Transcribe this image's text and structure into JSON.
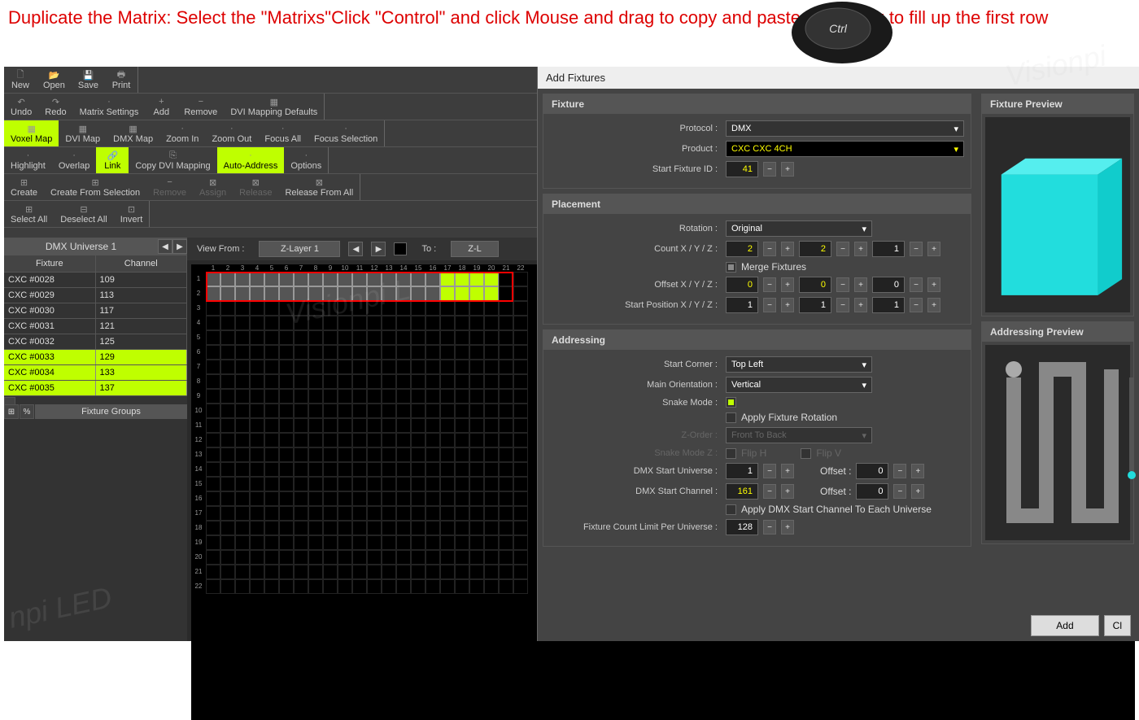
{
  "instruction": "Duplicate the Matrix: Select the \"Matrixs\"Click  \"Control\" and click Mouse and drag to copy and paste the matrix to fill up the first row",
  "toolbars": {
    "row1": [
      "New",
      "Open",
      "Save",
      "Print"
    ],
    "row2": [
      "Undo",
      "Redo",
      "Matrix Settings",
      "Add",
      "Remove",
      "DVI Mapping Defaults"
    ],
    "row3": [
      "Voxel Map",
      "DVI Map",
      "DMX Map",
      "Zoom In",
      "Zoom Out",
      "Focus All",
      "Focus Selection"
    ],
    "row4": [
      "Highlight",
      "Overlap",
      "Link",
      "Copy DVI Mapping",
      "Auto-Address",
      "Options"
    ],
    "row5": [
      "Create",
      "Create From Selection",
      "Remove",
      "Assign",
      "Release",
      "Release From All"
    ],
    "row6": [
      "Select All",
      "Deselect All",
      "Invert"
    ]
  },
  "dmx": {
    "title": "DMX Universe 1"
  },
  "fixture_table": {
    "headers": [
      "Fixture",
      "Channel"
    ],
    "rows": [
      {
        "f": "CXC #0028",
        "c": "109",
        "hl": false
      },
      {
        "f": "CXC #0029",
        "c": "113",
        "hl": false
      },
      {
        "f": "CXC #0030",
        "c": "117",
        "hl": false
      },
      {
        "f": "CXC #0031",
        "c": "121",
        "hl": false
      },
      {
        "f": "CXC #0032",
        "c": "125",
        "hl": false
      },
      {
        "f": "CXC #0033",
        "c": "129",
        "hl": true
      },
      {
        "f": "CXC #0034",
        "c": "133",
        "hl": true
      },
      {
        "f": "CXC #0035",
        "c": "137",
        "hl": true
      }
    ]
  },
  "fixture_groups": "Fixture Groups",
  "view": {
    "from_label": "View From :",
    "from_value": "Z-Layer 1",
    "to_label": "To :",
    "to_value": "Z-L"
  },
  "dialog": {
    "title": "Add Fixtures",
    "fixture": {
      "title": "Fixture",
      "protocol_label": "Protocol :",
      "protocol": "DMX",
      "product_label": "Product :",
      "product": "CXC CXC 4CH",
      "start_id_label": "Start Fixture ID :",
      "start_id": "41"
    },
    "placement": {
      "title": "Placement",
      "rotation_label": "Rotation :",
      "rotation": "Original",
      "count_label": "Count X / Y / Z :",
      "cx": "2",
      "cy": "2",
      "cz": "1",
      "merge_label": "Merge Fixtures",
      "offset_label": "Offset X / Y / Z :",
      "ox": "0",
      "oy": "0",
      "oz": "0",
      "start_label": "Start Position X / Y / Z :",
      "sx": "1",
      "sy": "1",
      "sz": "1"
    },
    "addressing": {
      "title": "Addressing",
      "corner_label": "Start Corner :",
      "corner": "Top Left",
      "orient_label": "Main Orientation :",
      "orient": "Vertical",
      "snake_label": "Snake Mode :",
      "applyrot_label": "Apply Fixture Rotation",
      "zorder_label": "Z-Order :",
      "zorder": "Front To Back",
      "snakez_label": "Snake Mode Z :",
      "fliph": "Flip H",
      "flipv": "Flip V",
      "dmxu_label": "DMX Start Universe :",
      "dmxu": "1",
      "offset1_label": "Offset :",
      "offset1": "0",
      "dmxc_label": "DMX Start Channel :",
      "dmxc": "161",
      "offset2_label": "Offset :",
      "offset2": "0",
      "applydmx_label": "Apply DMX Start Channel To Each Universe",
      "limit_label": "Fixture Count Limit Per Universe :",
      "limit": "128"
    },
    "preview_title": "Fixture Preview",
    "addr_preview_title": "Addressing Preview",
    "add_btn": "Add",
    "cancel_btn": "Cl"
  }
}
